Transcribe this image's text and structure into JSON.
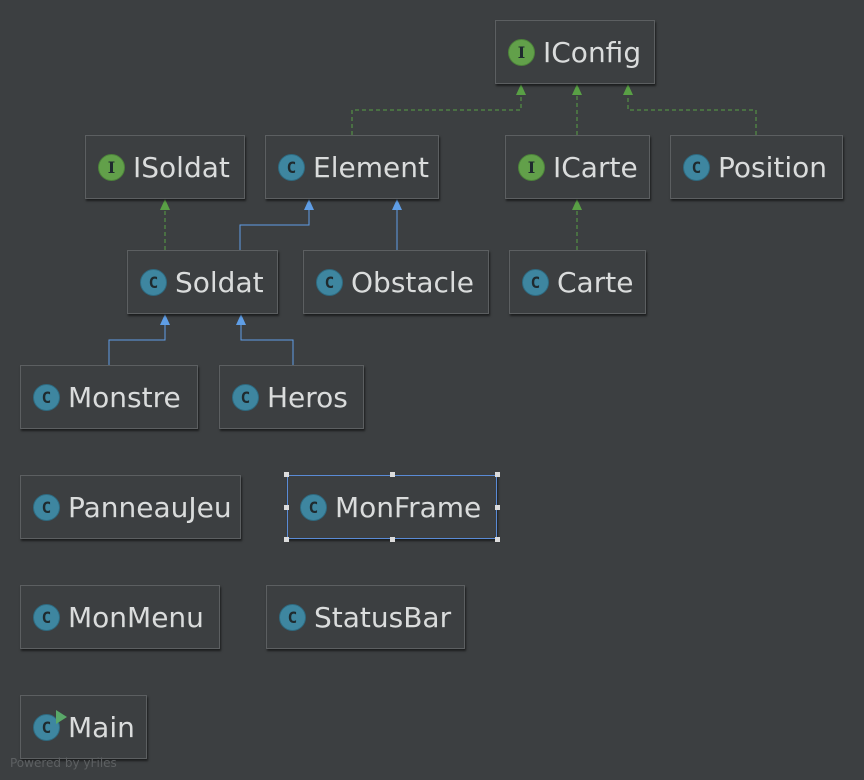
{
  "nodes": [
    {
      "id": "iconfig",
      "name": "IConfig",
      "kind": "interface",
      "kind_glyph": "I"
    },
    {
      "id": "isoldat",
      "name": "ISoldat",
      "kind": "interface",
      "kind_glyph": "I"
    },
    {
      "id": "element",
      "name": "Element",
      "kind": "class",
      "kind_glyph": "C"
    },
    {
      "id": "icarte",
      "name": "ICarte",
      "kind": "interface",
      "kind_glyph": "I"
    },
    {
      "id": "position",
      "name": "Position",
      "kind": "class",
      "kind_glyph": "C"
    },
    {
      "id": "soldat",
      "name": "Soldat",
      "kind": "class",
      "kind_glyph": "C"
    },
    {
      "id": "obstacle",
      "name": "Obstacle",
      "kind": "class",
      "kind_glyph": "C"
    },
    {
      "id": "carte",
      "name": "Carte",
      "kind": "class",
      "kind_glyph": "C"
    },
    {
      "id": "monstre",
      "name": "Monstre",
      "kind": "class",
      "kind_glyph": "C"
    },
    {
      "id": "heros",
      "name": "Heros",
      "kind": "class",
      "kind_glyph": "C"
    },
    {
      "id": "panneaujeu",
      "name": "PanneauJeu",
      "kind": "class",
      "kind_glyph": "C"
    },
    {
      "id": "monframe",
      "name": "MonFrame",
      "kind": "class",
      "kind_glyph": "C",
      "selected": true
    },
    {
      "id": "monmenu",
      "name": "MonMenu",
      "kind": "class",
      "kind_glyph": "C"
    },
    {
      "id": "statusbar",
      "name": "StatusBar",
      "kind": "class",
      "kind_glyph": "C"
    },
    {
      "id": "main",
      "name": "Main",
      "kind": "class",
      "kind_glyph": "C",
      "runnable": true
    }
  ],
  "relations": [
    {
      "from": "element",
      "to": "iconfig",
      "type": "implements"
    },
    {
      "from": "icarte",
      "to": "iconfig",
      "type": "extends-interface"
    },
    {
      "from": "position",
      "to": "iconfig",
      "type": "implements"
    },
    {
      "from": "soldat",
      "to": "isoldat",
      "type": "implements"
    },
    {
      "from": "soldat",
      "to": "element",
      "type": "extends"
    },
    {
      "from": "obstacle",
      "to": "element",
      "type": "extends"
    },
    {
      "from": "carte",
      "to": "icarte",
      "type": "implements"
    },
    {
      "from": "monstre",
      "to": "soldat",
      "type": "extends"
    },
    {
      "from": "heros",
      "to": "soldat",
      "type": "extends"
    }
  ],
  "colors": {
    "background": "#3c3f41",
    "node_border": "#5c5f61",
    "node_text": "#dadcdc",
    "class_badge": "#3e86a0",
    "interface_badge": "#62a04a",
    "extends_edge": "#5f9ee6",
    "implements_edge": "#59a045",
    "selection": "#5a8bd6",
    "run_marker": "#59a869"
  },
  "footer": {
    "watermark": "Powered by yFiles"
  }
}
